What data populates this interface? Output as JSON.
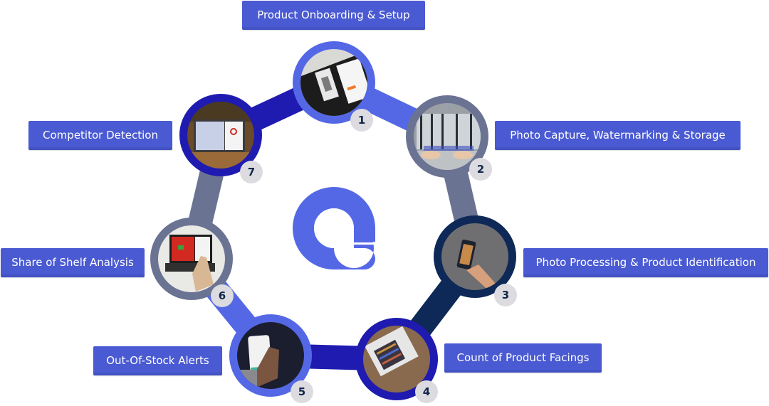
{
  "diagram": {
    "logo": {
      "icon": "brand-logo-icon",
      "color": "#5468E6"
    },
    "steps": [
      {
        "number": "1",
        "label": "Product Onboarding & Setup",
        "ring_color": "#5468E6",
        "photo": "tablet-and-phone-product-setup"
      },
      {
        "number": "2",
        "label": "Photo Capture, Watermarking & Storage",
        "ring_color": "#6B7393",
        "photo": "laptop-with-store-freezer-photo"
      },
      {
        "number": "3",
        "label": "Photo Processing & Product Identification",
        "ring_color": "#0E2957",
        "photo": "hand-holding-phone"
      },
      {
        "number": "4",
        "label": "Count of Product Facings",
        "ring_color": "#1F1BB0",
        "photo": "tablet-with-shelf-image"
      },
      {
        "number": "5",
        "label": "Out-Of-Stock Alerts",
        "ring_color": "#5468E6",
        "photo": "hand-holding-phone-alerts"
      },
      {
        "number": "6",
        "label": "Share of Shelf Analysis",
        "ring_color": "#6B7393",
        "photo": "tablet-shelf-analysis"
      },
      {
        "number": "7",
        "label": "Competitor Detection",
        "ring_color": "#1F1BB0",
        "photo": "tablet-on-bar-counter"
      }
    ]
  }
}
